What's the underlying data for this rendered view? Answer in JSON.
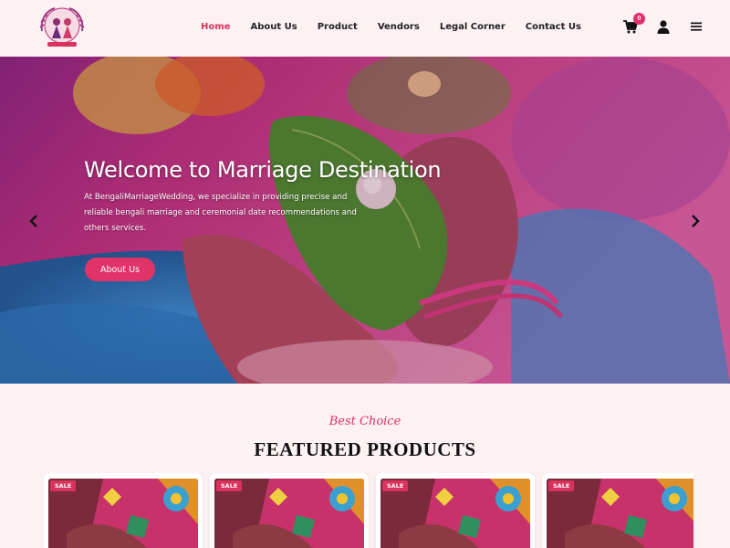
{
  "header": {
    "nav": [
      {
        "label": "Home",
        "active": true
      },
      {
        "label": "About Us",
        "active": false
      },
      {
        "label": "Product",
        "active": false
      },
      {
        "label": "Vendors",
        "active": false
      },
      {
        "label": "Legal Corner",
        "active": false
      },
      {
        "label": "Contact Us",
        "active": false
      }
    ],
    "cart_count": "0",
    "icons": [
      "cart-icon",
      "user-icon",
      "menu-icon"
    ]
  },
  "hero": {
    "title": "Welcome to Marriage Destination",
    "text": "At BengaliMarriageWedding, we specialize in providing precise and reliable bengali marriage and ceremonial date recommendations and others services.",
    "button_label": "About Us"
  },
  "featured": {
    "subtitle": "Best Choice",
    "title": "FEATURED PRODUCTS",
    "products": [
      {
        "badge": "SALE"
      },
      {
        "badge": "SALE"
      },
      {
        "badge": "SALE"
      },
      {
        "badge": "SALE"
      }
    ]
  },
  "colors": {
    "accent": "#e0336a",
    "background": "#fdf1f3"
  }
}
